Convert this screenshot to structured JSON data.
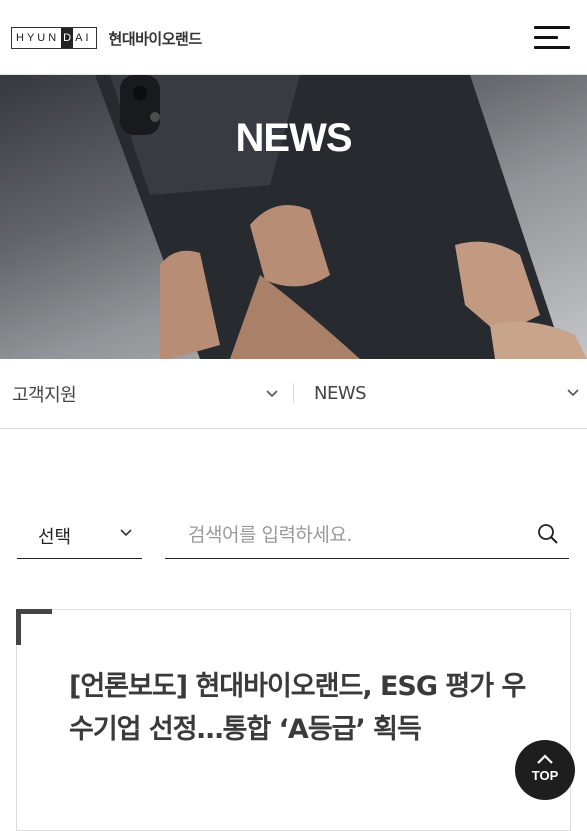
{
  "header": {
    "logo_brand": "HYUNDAI",
    "logo_name": "현대바이오랜드",
    "menu_icon": "hamburger-menu-icon"
  },
  "hero": {
    "title": "NEWS"
  },
  "breadcrumb": {
    "level1": "고객지원",
    "level2": "NEWS",
    "icon": "chevron-down-icon"
  },
  "search": {
    "select_value": "선택",
    "placeholder": "검색어를 입력하세요.",
    "icon": "search-icon"
  },
  "news": [
    {
      "title": "[언론보도] 현대바이오랜드, ESG 평가 우수기업 선정…통합 ‘A등급’ 획득"
    }
  ],
  "top_button": {
    "label": "TOP",
    "icon": "chevron-up-icon"
  },
  "colors": {
    "text_dark": "#222222",
    "border": "#d9d9d9",
    "top_btn_bg": "#1e1e1e",
    "corner": "#444444"
  }
}
